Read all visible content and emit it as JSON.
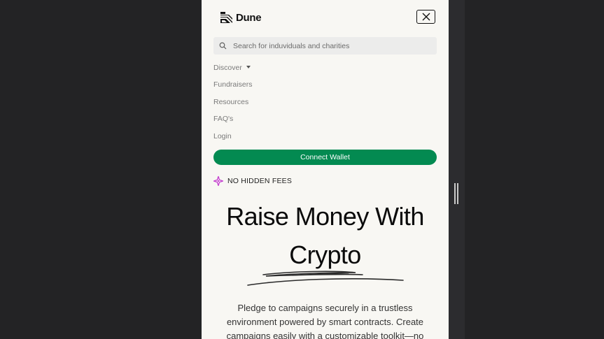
{
  "header": {
    "brand": "Dune"
  },
  "search": {
    "placeholder": "Search for induviduals and charities"
  },
  "nav": {
    "items": [
      {
        "label": "Discover"
      },
      {
        "label": "Fundraisers"
      },
      {
        "label": "Resources"
      },
      {
        "label": "FAQ's"
      },
      {
        "label": "Login"
      }
    ]
  },
  "cta": {
    "connect_wallet": "Connect Wallet"
  },
  "badge": {
    "text": "NO HIDDEN FEES"
  },
  "hero": {
    "title_line1": "Raise Money With",
    "title_line2": "Crypto",
    "description": "Pledge to campaigns securely in a trustless environment powered by smart contracts. Create campaigns easily with a customizable toolkit—no"
  },
  "colors": {
    "background": "#232325",
    "panel": "#f8f7f3",
    "accent_green": "#038a51",
    "badge_icon": "#c53fd0"
  },
  "icons": [
    "dune-logo-icon",
    "close-icon",
    "search-icon",
    "caret-down-icon",
    "sparkle-icon"
  ]
}
